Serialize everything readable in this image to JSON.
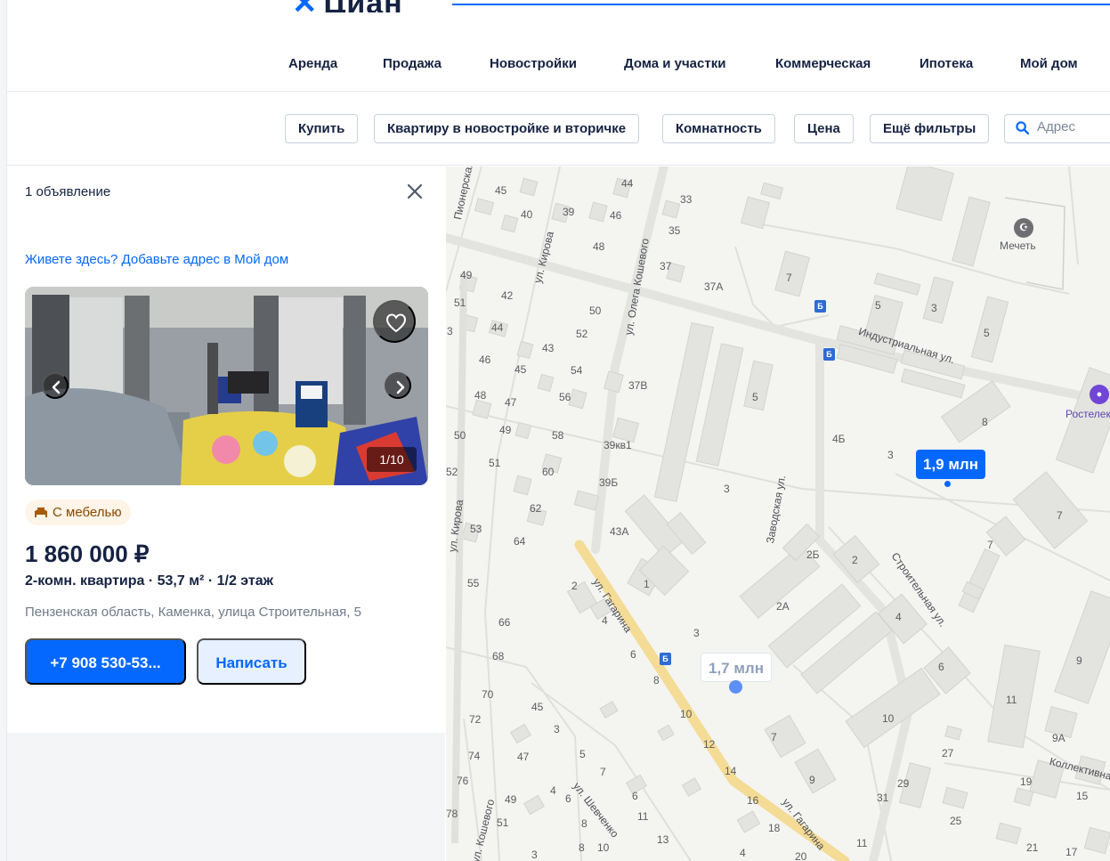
{
  "brand": {
    "logo_text": "Циан"
  },
  "nav": {
    "items": [
      "Аренда",
      "Продажа",
      "Новостройки",
      "Дома и участки",
      "Коммерческая",
      "Ипотека",
      "Мой дом"
    ]
  },
  "filters": {
    "buttons": [
      "Купить",
      "Квартиру в новостройке и вторичке",
      "Комнатность",
      "Цена",
      "Ещё фильтры"
    ],
    "search_placeholder": "Адрес"
  },
  "listing_panel": {
    "count_text": "1 объявление",
    "promo_text": "Живете здесь? Добавьте адрес в Мой дом",
    "photo_counter": "1/10",
    "badge": "С мебелью",
    "price": "1 860 000 ₽",
    "title": "2-комн. квартира · 53,7 м² · 1/2 этаж",
    "address": "Пензенская область, Каменка, улица Строительная, 5",
    "phone_button": "+7 908 530-53...",
    "write_button": "Написать"
  },
  "map": {
    "pins": {
      "active": "1,9 млн",
      "inactive": "1,7 млн"
    },
    "streets": [
      "Пионерская",
      "ул. Кирова",
      "ул. Олега Кошевого",
      "Индустриальная ул.",
      "Заводская ул.",
      "Строительная ул.",
      "ул. Гагарина",
      "ул. Шевченко",
      "Коллективная",
      "ул. Кирова",
      "ул. Кошевого"
    ],
    "poi": [
      "Мечеть",
      "Ростелеком"
    ],
    "building_numbers": [
      "45",
      "44",
      "33",
      "40",
      "39",
      "46",
      "35",
      "48",
      "37",
      "37А",
      "7",
      "49",
      "42",
      "50",
      "51",
      "52",
      "44",
      "43",
      "54",
      "3",
      "46",
      "45",
      "37В",
      "56",
      "48",
      "47",
      "5",
      "49",
      "58",
      "50",
      "39кв1",
      "51",
      "60",
      "39Б",
      "52",
      "62",
      "3",
      "53",
      "64",
      "43А",
      "55",
      "2",
      "1",
      "4",
      "66",
      "3",
      "68",
      "6",
      "8",
      "70",
      "45",
      "72",
      "3",
      "10",
      "74",
      "47",
      "5",
      "12",
      "7",
      "14",
      "76",
      "4",
      "6",
      "49",
      "78",
      "51",
      "8",
      "11",
      "13",
      "16",
      "18",
      "9",
      "10",
      "4",
      "20",
      "8",
      "6",
      "3",
      "4Б",
      "3",
      "2Б",
      "2",
      "2А",
      "4",
      "6",
      "7",
      "7",
      "10",
      "11",
      "9",
      "9А",
      "27",
      "29",
      "31",
      "25",
      "19",
      "15",
      "21",
      "17",
      "11",
      "3",
      "5",
      "8",
      "5",
      "7"
    ]
  },
  "colors": {
    "accent": "#0468ff",
    "text_primary": "#152242",
    "muted": "#707a89",
    "badge_bg": "#fff4e8",
    "badge_text": "#8a4800",
    "road_major": "#f4dc96"
  },
  "icons": {
    "close": "close-icon",
    "favorite": "heart-icon",
    "prev": "chevron-left-icon",
    "next": "chevron-right-icon",
    "search": "search-icon",
    "furniture": "sofa-icon"
  }
}
